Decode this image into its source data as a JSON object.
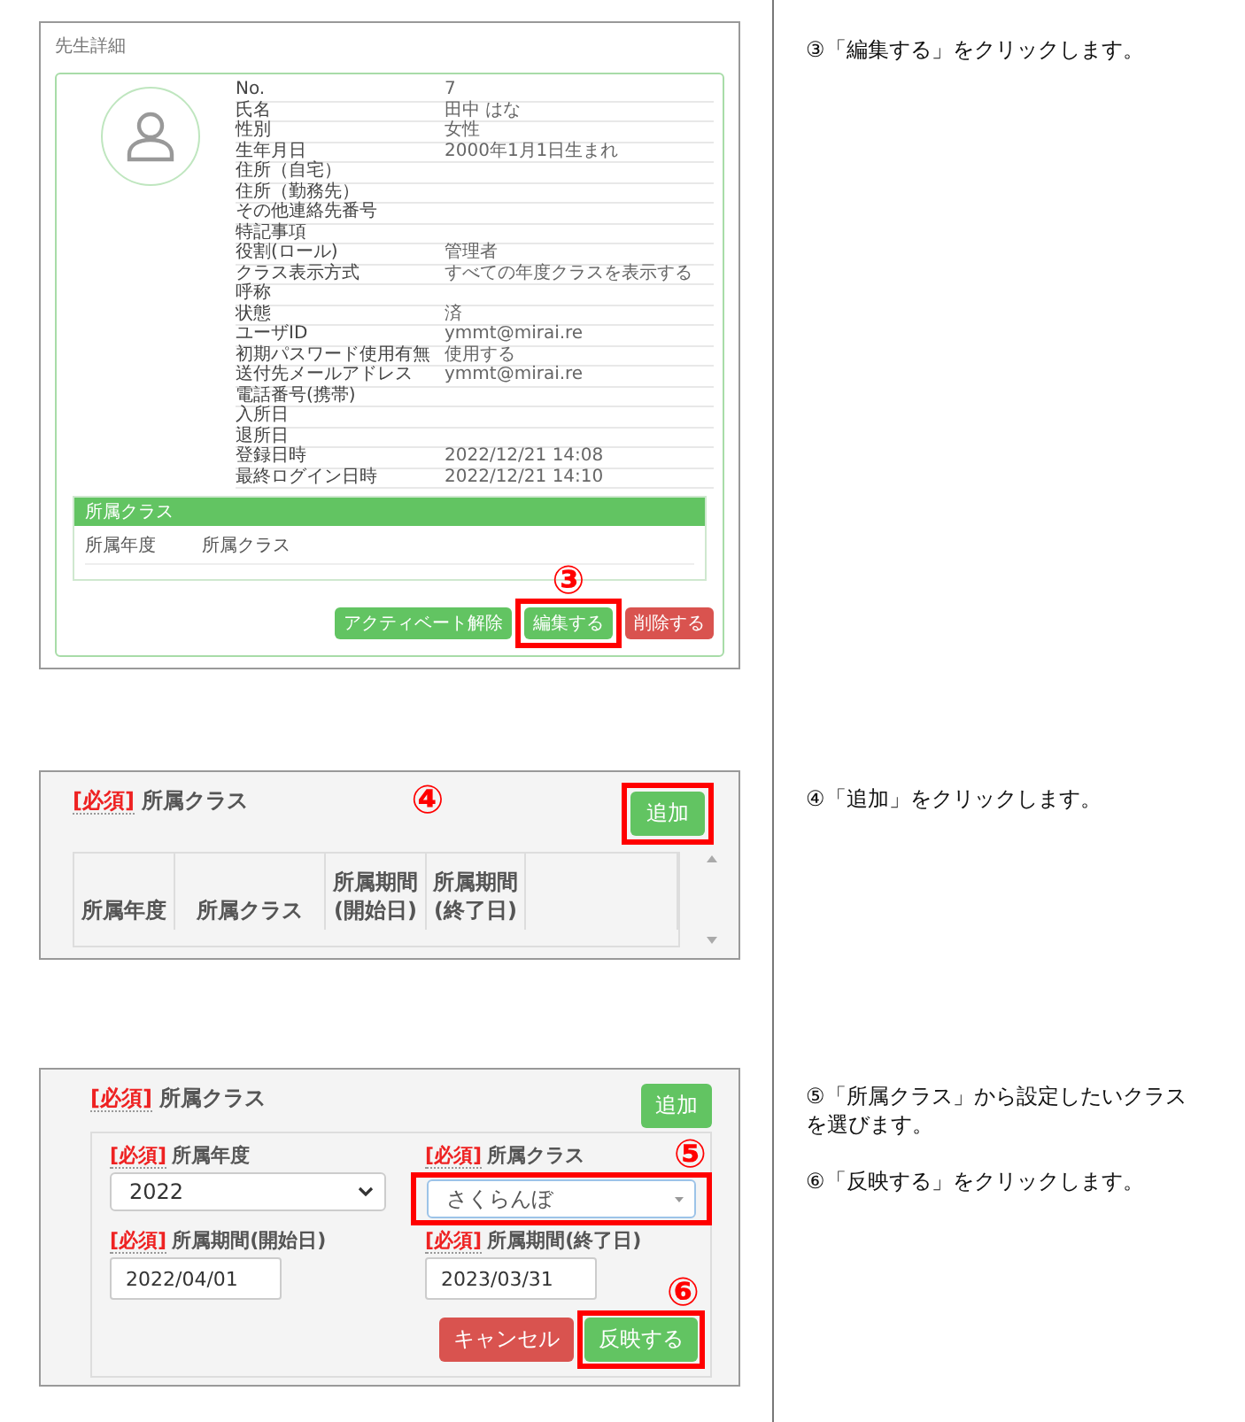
{
  "steps": [
    {
      "kind": "teacher_detail",
      "screen": {
        "title": "先生詳細",
        "fields": [
          {
            "label": "No.",
            "value": "7"
          },
          {
            "label": "氏名",
            "value": "田中 はな"
          },
          {
            "label": "性別",
            "value": "女性"
          },
          {
            "label": "生年月日",
            "value": "2000年1月1日生まれ"
          },
          {
            "label": "住所（自宅）"
          },
          {
            "label": "住所（勤務先）"
          },
          {
            "label": "その他連絡先番号"
          },
          {
            "label": "特記事項"
          },
          {
            "label": "役割(ロール)",
            "value": "管理者"
          },
          {
            "label": "クラス表示方式",
            "value": "すべての年度クラスを表示する"
          },
          {
            "label": "呼称"
          },
          {
            "label": "状態",
            "value": "済"
          },
          {
            "label": "ユーザID",
            "value": "ymmt@mirai.re"
          },
          {
            "label": "初期パスワード使用有無",
            "value": "使用する"
          },
          {
            "label": "送付先メールアドレス",
            "value": "ymmt@mirai.re"
          },
          {
            "label": "電話番号(携帯)"
          },
          {
            "label": "入所日"
          },
          {
            "label": "退所日"
          },
          {
            "label": "登録日時",
            "value": "2022/12/21 14:08"
          },
          {
            "label": "最終ログイン日時",
            "value": "2022/12/21 14:10"
          }
        ],
        "class_panel": {
          "title": "所属クラス",
          "columns": [
            "所属年度",
            "所属クラス"
          ]
        },
        "buttons": [
          {
            "label": "アクティベート解除",
            "kind": "success",
            "highlighted": false
          },
          {
            "label": "編集する",
            "kind": "success",
            "highlighted": true,
            "callout": "③"
          },
          {
            "label": "削除する",
            "kind": "danger",
            "highlighted": false
          }
        ]
      },
      "instructions": [
        "③「編集する」をクリックします。"
      ]
    },
    {
      "kind": "class_table",
      "screen": {
        "required_tag": "[必須]",
        "label": "所属クラス",
        "callout": "④",
        "add_button": {
          "label": "追加",
          "highlighted": true
        },
        "columns": [
          "所属年度",
          "所属クラス",
          "所属期間\n(開始日)",
          "所属期間\n(終了日)"
        ]
      },
      "instructions": [
        "④「追加」をクリックします。"
      ]
    },
    {
      "kind": "class_form",
      "screen": {
        "required_tag": "[必須]",
        "label": "所属クラス",
        "add_button": {
          "label": "追加",
          "highlighted": false
        },
        "fields": [
          {
            "kind": "select",
            "required_tag": "[必須]",
            "label": "所属年度",
            "value": "2022",
            "highlighted": false
          },
          {
            "kind": "combo",
            "required_tag": "[必須]",
            "label": "所属クラス",
            "value": "さくらんぼ",
            "highlighted": true,
            "callout": "⑤"
          },
          {
            "kind": "date",
            "required_tag": "[必須]",
            "label": "所属期間(開始日)",
            "value": "2022/04/01",
            "highlighted": false
          },
          {
            "kind": "date",
            "required_tag": "[必須]",
            "label": "所属期間(終了日)",
            "value": "2023/03/31",
            "highlighted": false
          }
        ],
        "buttons": [
          {
            "label": "キャンセル",
            "kind": "danger",
            "highlighted": false
          },
          {
            "label": "反映する",
            "kind": "success",
            "highlighted": true,
            "callout": "⑥"
          }
        ]
      },
      "instructions": [
        "⑤「所属クラス」から設定したいクラスを選びます。",
        "⑥「反映する」をクリックします。"
      ]
    }
  ]
}
